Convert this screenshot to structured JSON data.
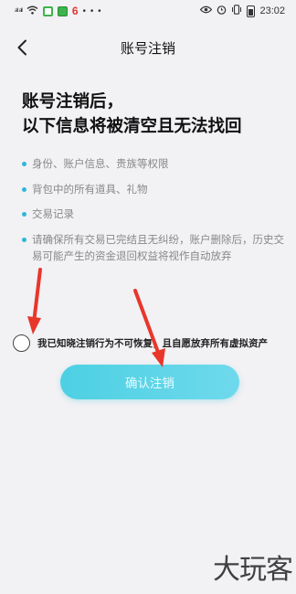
{
  "status_bar": {
    "signal_left": "⁶²‥̲ ⁶²‥̲",
    "badge_number": "6",
    "dots": "• • •",
    "time": "23:02"
  },
  "nav": {
    "title": "账号注销"
  },
  "headline": {
    "line1": "账号注销后，",
    "line2": "以下信息将被清空且无法找回"
  },
  "info_items": [
    "身份、账户信息、贵族等权限",
    "背包中的所有道具、礼物",
    "交易记录",
    "请确保所有交易已完结且无纠纷，账户删除后，历史交易可能产生的资金退回权益将视作自动放弃"
  ],
  "agree": {
    "text": "我已知晓注销行为不可恢复，且自愿放弃所有虚拟资产",
    "checked": false
  },
  "confirm_button": {
    "label": "确认注销"
  },
  "watermark": {
    "text": "大玩客"
  },
  "colors": {
    "accent": "#4dd0e3",
    "bullet": "#2fb7d8",
    "annotation_arrow": "#e8362b"
  }
}
